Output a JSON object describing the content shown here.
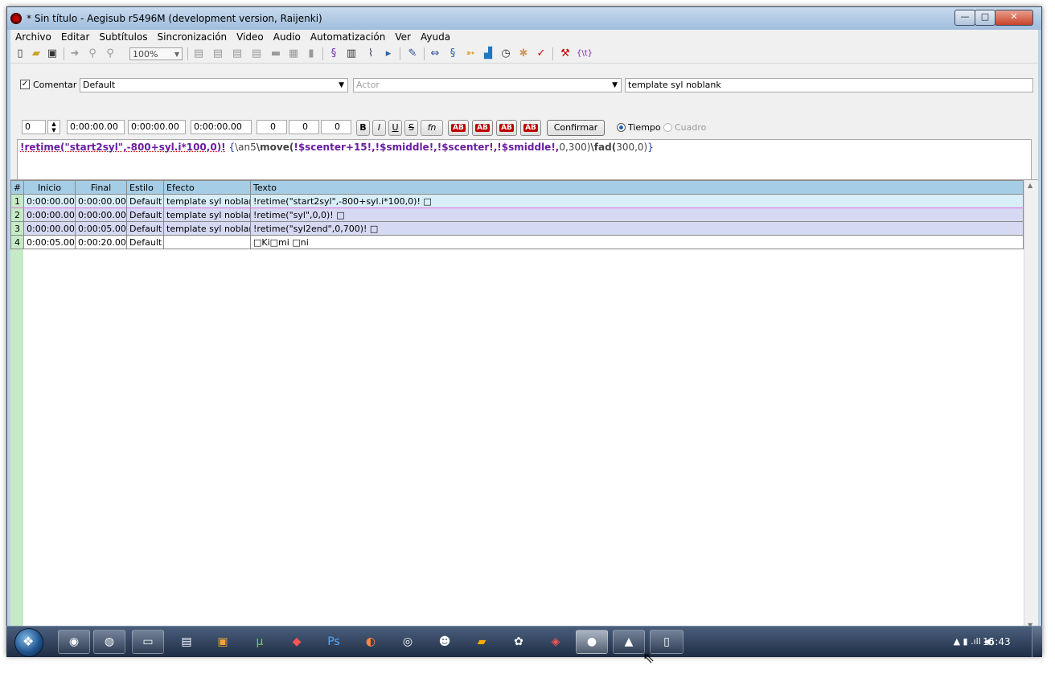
{
  "window": {
    "title": "* Sin título - Aegisub r5496M (development version, Raijenki)",
    "min_glyph": "—",
    "max_glyph": "□",
    "close_glyph": "✕"
  },
  "menu": [
    "Archivo",
    "Editar",
    "Subtítulos",
    "Sincronización",
    "Video",
    "Audio",
    "Automatización",
    "Ver",
    "Ayuda"
  ],
  "toolbar": {
    "zoom": "100%",
    "icons": [
      "new-file-icon",
      "open-folder-icon",
      "save-icon",
      "jump-to-icon",
      "zoom-in-icon",
      "zoom-out-icon",
      "align-top-icon",
      "align-bottom-icon",
      "align-left-icon",
      "align-right-icon",
      "video-icon",
      "grid-icon",
      "detach-video-icon",
      "styles-icon",
      "properties-icon",
      "attachments-icon",
      "fonts-collector-icon",
      "automation-icon",
      "resample-icon",
      "translation-icon",
      "style-manager-icon",
      "timing-postprocessor-icon",
      "kanji-timer-icon",
      "spell-checker-icon",
      "options-icon",
      "hotkeys-icon"
    ]
  },
  "edit": {
    "comment_label": "Comentar",
    "comment_checked": true,
    "style": "Default",
    "actor_placeholder": "Actor",
    "effect": "template syl noblank",
    "layer": "0",
    "start": "0:00:00.00",
    "end": "0:00:00.00",
    "duration": "0:00:00.00",
    "margin_l": "0",
    "margin_r": "0",
    "margin_v": "0",
    "bold": "B",
    "italic": "I",
    "underline": "U",
    "strike": "S",
    "fn": "fn",
    "color_labels": [
      "AB",
      "AB",
      "AB",
      "AB"
    ],
    "confirm": "Confirmar",
    "time_label": "Tiempo",
    "frame_label": "Cuadro",
    "text_parts": {
      "retime": "!retime(\"start2syl\",-800+syl.i*100,0)!",
      "open_brace": "{",
      "an5": "\\an5",
      "move": "\\move(",
      "move_args": "!$scenter+15!,!$smiddle!,!$scenter!,!$smiddle!,",
      "move_tail": "0,300)",
      "fad": "\\fad(",
      "fad_args": "300,0)",
      "close_brace": "}"
    }
  },
  "grid": {
    "headers": [
      "#",
      "Inicio",
      "Final",
      "Estilo",
      "Efecto",
      "Texto"
    ],
    "rows": [
      {
        "num": "1",
        "start": "0:00:00.00",
        "end": "0:00:00.00",
        "style": "Default",
        "effect": "template syl noblank",
        "text": "!retime(\"start2syl\",-800+syl.i*100,0)! □"
      },
      {
        "num": "2",
        "start": "0:00:00.00",
        "end": "0:00:00.00",
        "style": "Default",
        "effect": "template syl noblank",
        "text": "!retime(\"syl\",0,0)! □"
      },
      {
        "num": "3",
        "start": "0:00:00.00",
        "end": "0:00:05.00",
        "style": "Default",
        "effect": "template syl noblank",
        "text": "!retime(\"syl2end\",0,700)! □"
      },
      {
        "num": "4",
        "start": "0:00:05.00",
        "end": "0:00:20.00",
        "style": "Default",
        "effect": "",
        "text": "□Ki□mi □ni"
      }
    ]
  },
  "taskbar": {
    "clock": "15:43",
    "tray": "▲ ▮ .ıll ◀)"
  }
}
